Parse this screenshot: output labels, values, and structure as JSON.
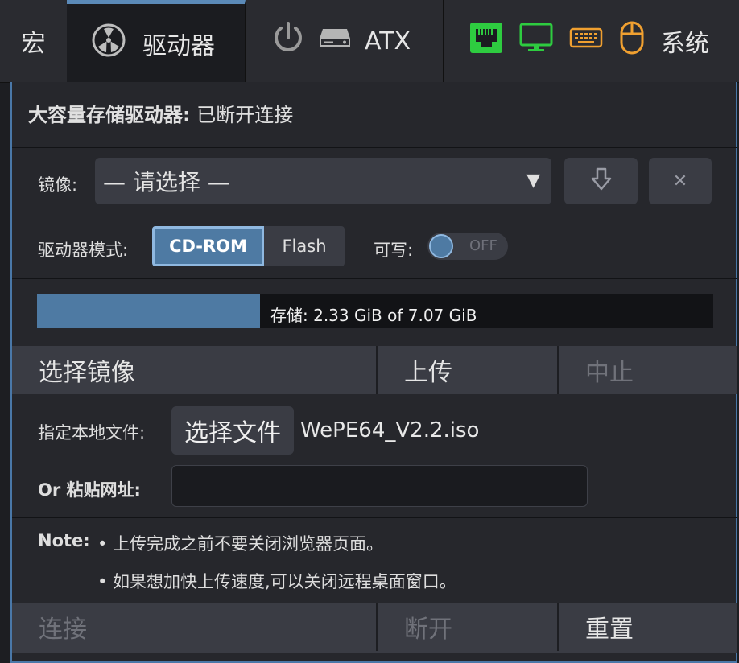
{
  "menu": {
    "macro": "宏",
    "drive": "驱动器",
    "atx": "ATX",
    "system": "系统",
    "icons": [
      "fan-icon",
      "power-icon",
      "hdd-icon",
      "network-icon",
      "monitor-icon",
      "keyboard-icon",
      "mouse-icon"
    ],
    "colors": {
      "active_border": "#5b8ab8",
      "network": "#2ecc40",
      "monitor": "#2ecc40",
      "keyboard": "#f0a030",
      "mouse": "#f0a030"
    }
  },
  "drive": {
    "title_label": "大容量存储驱动器:",
    "title_status": "已断开连接",
    "image_label": "镜像:",
    "image_placeholder": "— 请选择 —",
    "mode_label": "驱动器模式:",
    "mode_options": [
      "CD-ROM",
      "Flash"
    ],
    "mode_selected": "CD-ROM",
    "writable_label": "可写:",
    "writable_value": "OFF",
    "storage_text": "存储: 2.33 GiB of 7.07 GiB",
    "storage_used_fraction": 0.33
  },
  "upload": {
    "tab_select": "选择镜像",
    "tab_upload": "上传",
    "tab_abort": "中止",
    "local_label": "指定本地文件:",
    "choose_file": "选择文件",
    "file_name": "WePE64_V2.2.iso",
    "url_label": "Or 粘贴网址:",
    "url_value": "",
    "note_label": "Note:",
    "note_1": "• 上传完成之前不要关闭浏览器页面。",
    "note_2": "• 如果想加快上传速度,可以关闭远程桌面窗口。"
  },
  "actions": {
    "connect": "连接",
    "disconnect": "断开",
    "reset": "重置"
  },
  "accent": "#4e7aa3"
}
